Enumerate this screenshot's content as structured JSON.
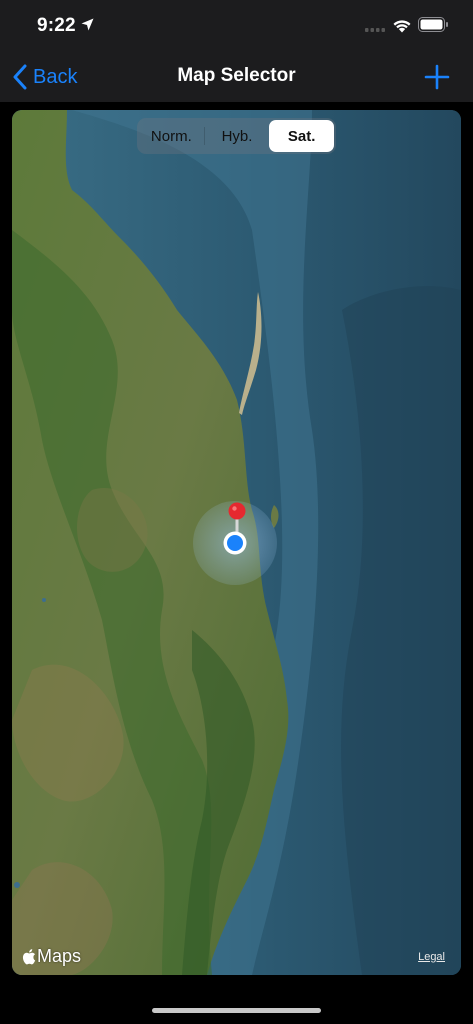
{
  "status_bar": {
    "time": "9:22"
  },
  "nav": {
    "back_label": "Back",
    "title": "Map Selector",
    "accent_color": "#1a82fb"
  },
  "map_type_control": {
    "options": [
      "Norm.",
      "Hyb.",
      "Sat."
    ],
    "selected": "Sat."
  },
  "map": {
    "attribution": "Maps",
    "legal_label": "Legal"
  },
  "icons": [
    "location-arrow-icon",
    "cellular-signal-icon",
    "wifi-icon",
    "battery-icon",
    "back-chevron-icon",
    "plus-icon",
    "map-pin-icon",
    "user-location-icon",
    "apple-logo-icon"
  ]
}
